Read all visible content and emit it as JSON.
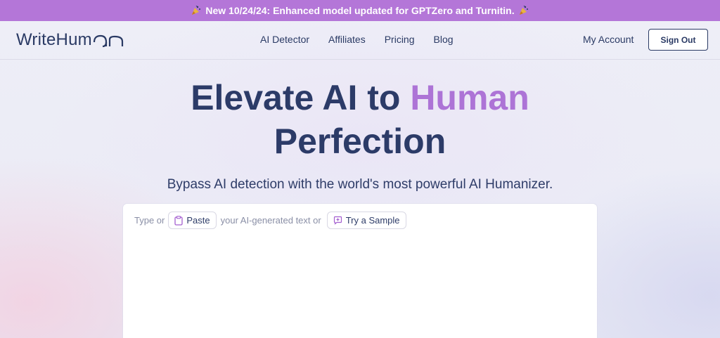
{
  "announcement": {
    "text": "New 10/24/24: Enhanced model updated for GPTZero and Turnitin."
  },
  "header": {
    "logo_text": "WriteHum",
    "logo_suffix_graphic": "an",
    "nav": [
      {
        "label": "AI Detector"
      },
      {
        "label": "Affiliates"
      },
      {
        "label": "Pricing"
      },
      {
        "label": "Blog"
      }
    ],
    "my_account": "My Account",
    "sign_out": "Sign Out"
  },
  "hero": {
    "title_part1": "Elevate AI to ",
    "title_accent": "Human",
    "title_line2": "Perfection",
    "subtitle": "Bypass AI detection with the world's most powerful AI Humanizer."
  },
  "editor": {
    "type_or": "Type or",
    "paste_label": "Paste",
    "middle_text": "your AI-generated text or",
    "sample_label": "Try a Sample"
  },
  "colors": {
    "banner": "#b476d8",
    "accent": "#ad74d6",
    "navy": "#2a3a64"
  },
  "icons": [
    "party-popper-icon",
    "clipboard-icon",
    "sample-icon"
  ]
}
